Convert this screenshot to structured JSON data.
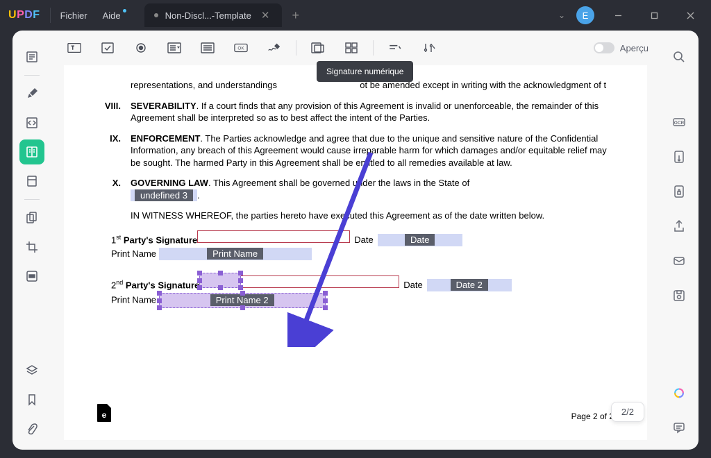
{
  "app": {
    "logo": "UPDF"
  },
  "menubar": {
    "file": "Fichier",
    "help": "Aide"
  },
  "tab": {
    "title": "Non-Discl...-Template"
  },
  "avatar": {
    "initial": "E"
  },
  "tooltip": {
    "signature": "Signature numérique"
  },
  "preview": {
    "label": "Aperçu"
  },
  "doc": {
    "para0": "representations, and understandings",
    "para0b": "ot be amended except in writing with the acknowledgment of t",
    "sec8_num": "VIII.",
    "sec8_title": "SEVERABILITY",
    "sec8_body": ". If a court finds that any provision of this Agreement is invalid or unenforceable, the remainder of this Agreement shall be interpreted so as to best affect the intent of the Parties.",
    "sec9_num": "IX.",
    "sec9_title": "ENFORCEMENT",
    "sec9_body": ". The Parties acknowledge and agree that due to the unique and sensitive nature of the Confidential Information, any breach of this Agreement would cause irreparable harm for which damages and/or equitable relief may be sought. The harmed Party in this Agreement shall be entitled to all remedies available at law.",
    "sec10_num": "X.",
    "sec10_title": "GOVERNING LAW",
    "sec10_body1": ". This Agreement shall be governed under the laws in the State of ",
    "undefined3": "undefined 3",
    "witness": "IN WITNESS WHEREOF, the parties hereto have executed this Agreement as of the date written below.",
    "party1_sig": " Party's Signature",
    "party1_sup": "1",
    "party1_st": "st",
    "date_label": "Date",
    "date_field": "Date",
    "print_name_label": "Print Name ",
    "print_name_field": "Print Name",
    "party2_sup": "2",
    "party2_nd": "nd",
    "party2_sig": " Party's Signature",
    "date2_field": "Date 2",
    "print_name2_field": "Print Name 2",
    "page_footer": "Page 2 of 2",
    "stamp": "e"
  },
  "page_badge": "2/2"
}
